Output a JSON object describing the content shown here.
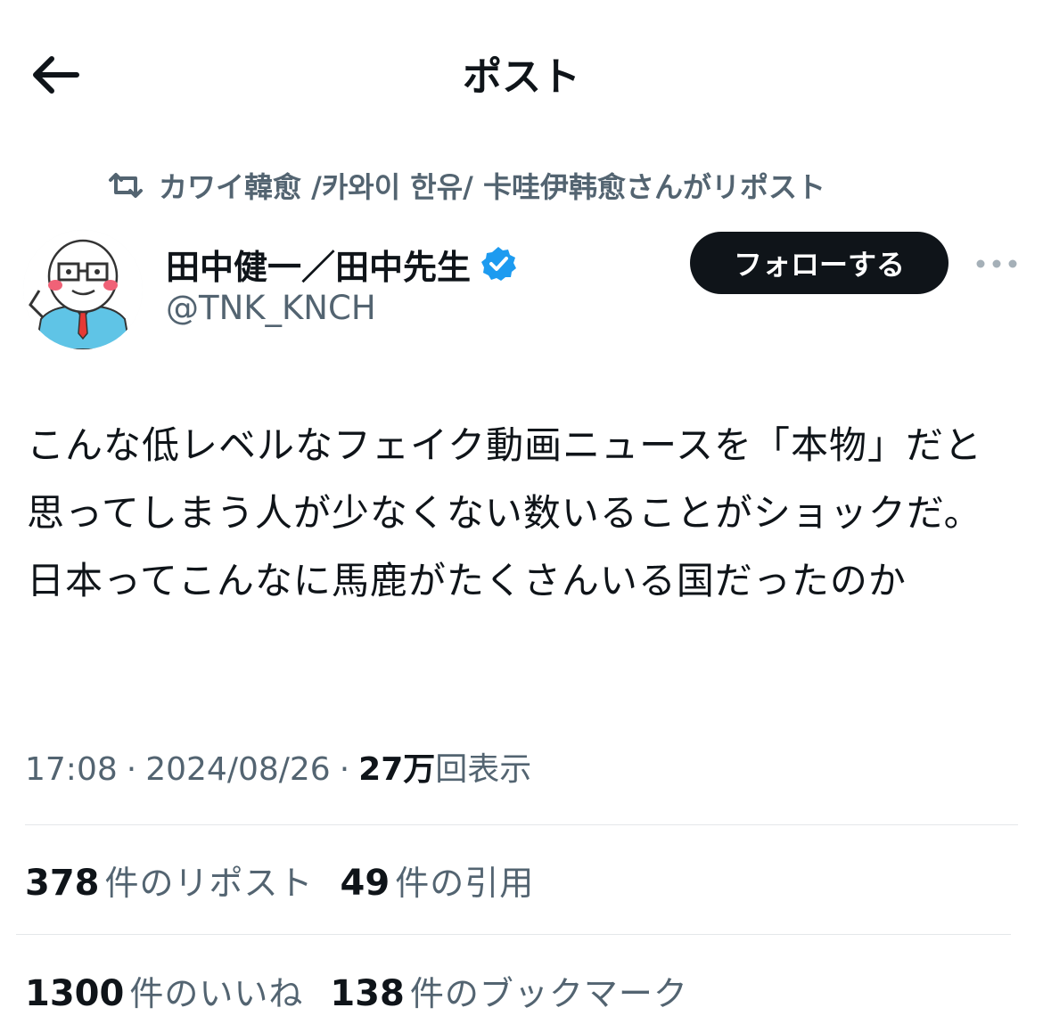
{
  "header": {
    "title": "ポスト",
    "back_icon": "arrow-left-icon"
  },
  "repost": {
    "icon": "repost-icon",
    "text": "カワイ韓愈 /카와이 한유/ 卡哇伊韩愈さんがリポスト"
  },
  "author": {
    "name": "田中健一／田中先生",
    "handle": "@TNK_KNCH",
    "verified": true,
    "verified_color": "#1d9bf0"
  },
  "actions": {
    "follow_label": "フォローする",
    "more_icon": "more-dots-icon"
  },
  "tweet": {
    "text": "こんな低レベルなフェイク動画ニュースを「本物」だと思ってしまう人が少なくない数いることがショックだ。日本ってこんなに馬鹿がたくさんいる国だったのか"
  },
  "meta": {
    "time": "17:08",
    "sep1": "·",
    "date": "2024/08/26",
    "sep2": "·",
    "views_count": "27万",
    "views_label": "回表示"
  },
  "stats": {
    "reposts_count": "378",
    "reposts_label": "件のリポスト",
    "quotes_count": "49",
    "quotes_label": "件の引用",
    "likes_count": "1300",
    "likes_label": "件のいいね",
    "bookmarks_count": "138",
    "bookmarks_label": "件のブックマーク"
  },
  "colors": {
    "text": "#0f1419",
    "secondary": "#536471",
    "button_bg": "#0f1419",
    "divider": "#e4e7ea"
  }
}
